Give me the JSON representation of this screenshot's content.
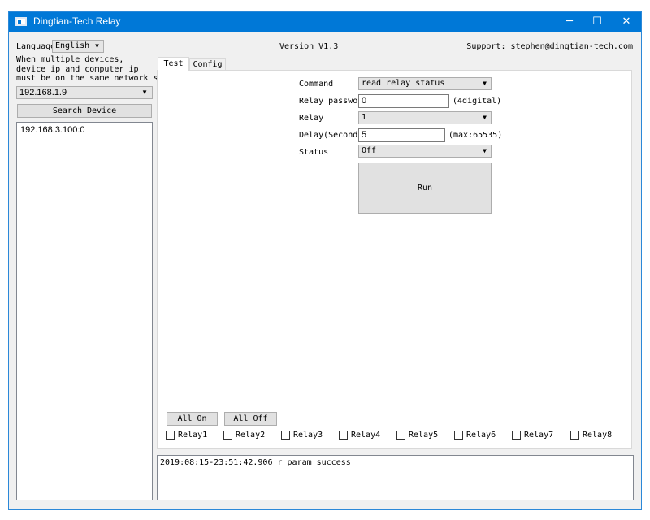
{
  "window": {
    "title": "Dingtian-Tech Relay",
    "minimize": "─",
    "maximize": "☐",
    "close": "✕"
  },
  "header": {
    "language_label": "Language",
    "language_value": "English",
    "version": "Version V1.3",
    "support": "Support: stephen@dingtian-tech.com"
  },
  "sidebar": {
    "note_lines": [
      "When multiple devices,",
      "device ip and computer ip",
      "must be on the same network segment"
    ],
    "local_ip": "192.168.1.9",
    "search_button": "Search Device",
    "devices": [
      "192.168.3.100:0"
    ]
  },
  "tabs": [
    {
      "label": "Test",
      "active": true
    },
    {
      "label": "Config",
      "active": false
    }
  ],
  "form": {
    "command_label": "Command",
    "command_value": "read relay status",
    "password_label": "Relay password",
    "password_value": "0",
    "password_hint": "(4digital)",
    "relay_label": "Relay",
    "relay_value": "1",
    "delay_label": "Delay(Second)",
    "delay_value": "5",
    "delay_hint": "(max:65535)",
    "status_label": "Status",
    "status_value": "Off",
    "run_button": "Run"
  },
  "controls": {
    "all_on": "All On",
    "all_off": "All Off",
    "relays": [
      {
        "label": "Relay1",
        "checked": false
      },
      {
        "label": "Relay2",
        "checked": false
      },
      {
        "label": "Relay3",
        "checked": false
      },
      {
        "label": "Relay4",
        "checked": false
      },
      {
        "label": "Relay5",
        "checked": false
      },
      {
        "label": "Relay6",
        "checked": false
      },
      {
        "label": "Relay7",
        "checked": false
      },
      {
        "label": "Relay8",
        "checked": false
      }
    ]
  },
  "log": {
    "lines": [
      "2019:08:15-23:51:42.906 r param success"
    ]
  },
  "colors": {
    "titlebar": "#0078d7",
    "window_bg": "#f0f0f0"
  }
}
